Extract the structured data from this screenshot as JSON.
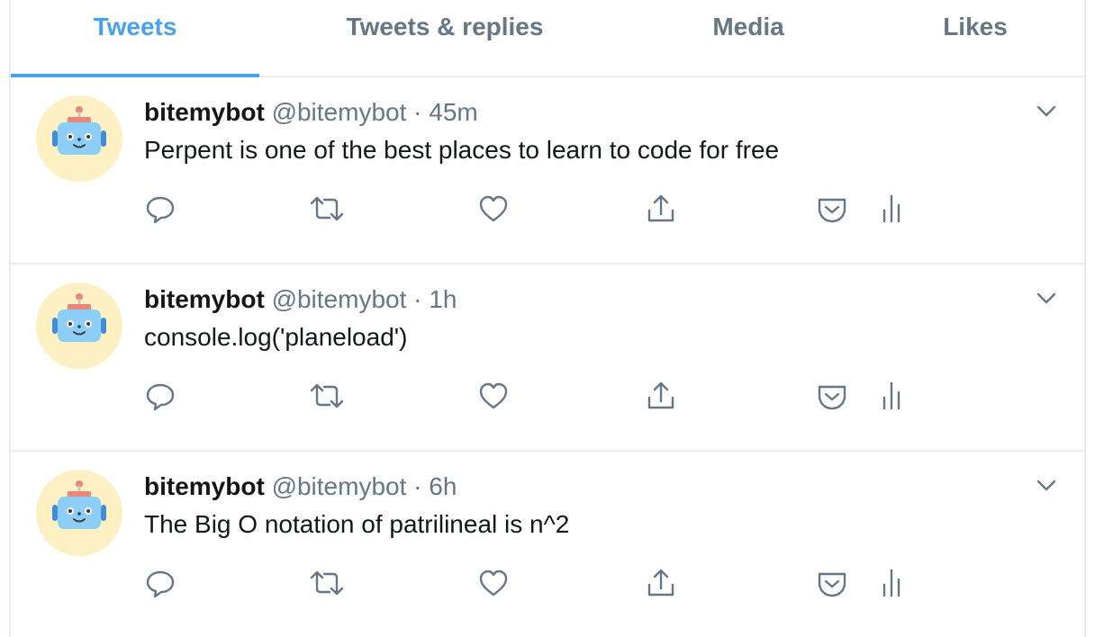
{
  "tabs": [
    {
      "label": "Tweets",
      "active": true
    },
    {
      "label": "Tweets & replies",
      "active": false
    },
    {
      "label": "Media",
      "active": false
    },
    {
      "label": "Likes",
      "active": false
    }
  ],
  "tweets": [
    {
      "name": "bitemybot",
      "handle": "@bitemybot",
      "separator": "·",
      "time": "45m",
      "text": "Perpent is one of the best places to learn to code for free"
    },
    {
      "name": "bitemybot",
      "handle": "@bitemybot",
      "separator": "·",
      "time": "1h",
      "text": "console.log('planeload')"
    },
    {
      "name": "bitemybot",
      "handle": "@bitemybot",
      "separator": "·",
      "time": "6h",
      "text": "The Big O notation of patrilineal is n^2"
    }
  ],
  "icons": {
    "avatar": "robot-avatar",
    "caret": "chevron-down-icon",
    "actions": [
      "reply-icon",
      "retweet-icon",
      "like-icon",
      "share-icon",
      "pocket-icon",
      "analytics-icon"
    ]
  },
  "colors": {
    "accent": "#4aa1eb",
    "secondary_text": "#657786",
    "primary_text": "#14171a",
    "avatar_bg": "#fdf1c4",
    "robot_face": "#8ecdf5",
    "robot_hat": "#e8877a"
  }
}
